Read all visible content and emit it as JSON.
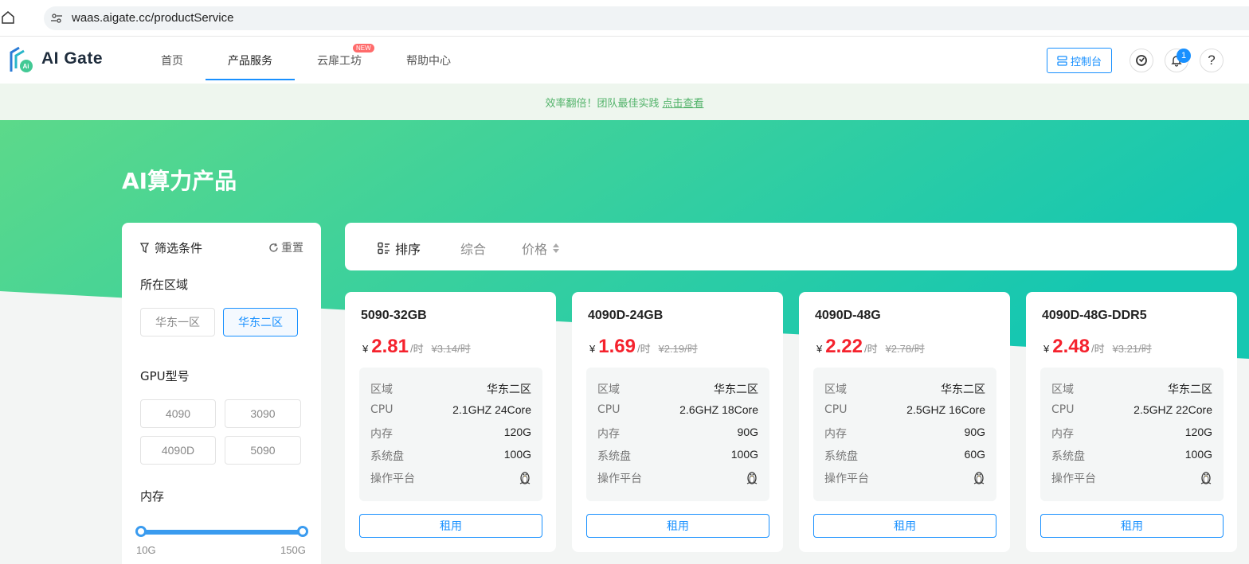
{
  "browser": {
    "url": "waas.aigate.cc/productService"
  },
  "nav": {
    "logo_text": "AI Gate",
    "items": [
      {
        "label": "首页"
      },
      {
        "label": "产品服务"
      },
      {
        "label": "云扉工坊"
      },
      {
        "label": "帮助中心"
      }
    ],
    "new_badge": "NEW",
    "console_label": "控制台",
    "notification_count": "1"
  },
  "promo": {
    "text": "效率翻倍！团队最佳实践",
    "link": "点击查看"
  },
  "page_title": "AI算力产品",
  "filter": {
    "title": "筛选条件",
    "reset": "重置",
    "region_label": "所在区域",
    "regions": [
      "华东一区",
      "华东二区"
    ],
    "gpu_label": "GPU型号",
    "gpus": [
      "4090",
      "3090",
      "4090D",
      "5090"
    ],
    "memory_label": "内存",
    "memory_min": "10G",
    "memory_max": "150G"
  },
  "sort": {
    "label": "排序",
    "general": "综合",
    "price": "价格"
  },
  "spec_keys": {
    "region": "区域",
    "cpu": "CPU",
    "memory": "内存",
    "disk": "系统盘",
    "platform": "操作平台"
  },
  "currency": "¥",
  "per_hour": "/时",
  "rent_label": "租用",
  "products": [
    {
      "name": "5090-32GB",
      "price": "2.81",
      "old_price": "¥3.14/时",
      "region": "华东二区",
      "cpu": "2.1GHZ 24Core",
      "memory": "120G",
      "disk": "100G"
    },
    {
      "name": "4090D-24GB",
      "price": "1.69",
      "old_price": "¥2.19/时",
      "region": "华东二区",
      "cpu": "2.6GHZ 18Core",
      "memory": "90G",
      "disk": "100G"
    },
    {
      "name": "4090D-48G",
      "price": "2.22",
      "old_price": "¥2.78/时",
      "region": "华东二区",
      "cpu": "2.5GHZ 16Core",
      "memory": "90G",
      "disk": "60G"
    },
    {
      "name": "4090D-48G-DDR5",
      "price": "2.48",
      "old_price": "¥3.21/时",
      "region": "华东二区",
      "cpu": "2.5GHZ 22Core",
      "memory": "120G",
      "disk": "100G"
    }
  ],
  "colors": {
    "accent": "#1890ff",
    "price": "#f5222d",
    "hero_start": "#5cd98a",
    "hero_end": "#16c7b1",
    "promo_text": "#52b36a"
  }
}
